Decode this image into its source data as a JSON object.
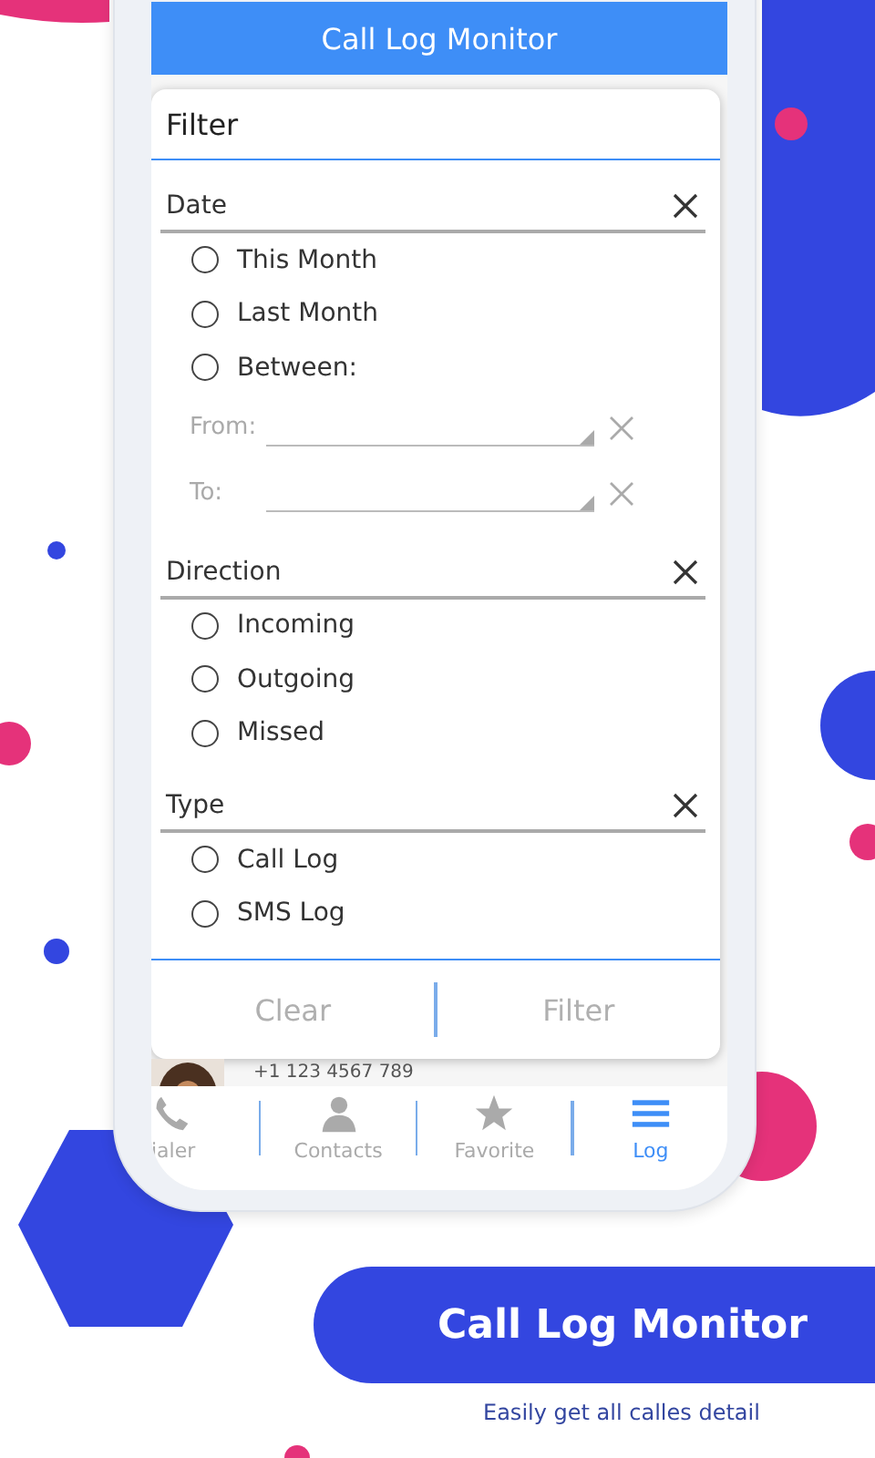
{
  "app_bar": {
    "title": "Call Log Monitor"
  },
  "filter": {
    "title": "Filter",
    "sections": [
      {
        "title": "Date",
        "options": [
          {
            "label": "This Month",
            "selected": false
          },
          {
            "label": "Last Month",
            "selected": false
          },
          {
            "label": "Between:",
            "selected": false
          }
        ],
        "range": {
          "disabled": true,
          "fields": [
            {
              "label": "From:"
            },
            {
              "label": "To:"
            }
          ]
        }
      },
      {
        "title": "Direction",
        "options": [
          {
            "label": "Incoming",
            "selected": false
          },
          {
            "label": "Outgoing",
            "selected": false
          },
          {
            "label": "Missed",
            "selected": false
          }
        ]
      },
      {
        "title": "Type",
        "options": [
          {
            "label": "Call Log",
            "selected": false
          },
          {
            "label": "SMS Log",
            "selected": false
          }
        ]
      }
    ],
    "buttons": [
      {
        "label": "Clear"
      },
      {
        "label": "Filter"
      }
    ]
  },
  "behind_row": {
    "phone": "+1 123 4567 789"
  },
  "nav": [
    {
      "label": "ialer",
      "kind": "phone",
      "selected": false
    },
    {
      "label": "Contacts",
      "kind": "person",
      "selected": false
    },
    {
      "label": "Favorite",
      "kind": "star",
      "selected": false
    },
    {
      "label": "Log",
      "kind": "menu",
      "selected": true
    }
  ],
  "banner": {
    "title": "Call Log Monitor",
    "subtitle": "Easily get all calles detail"
  }
}
